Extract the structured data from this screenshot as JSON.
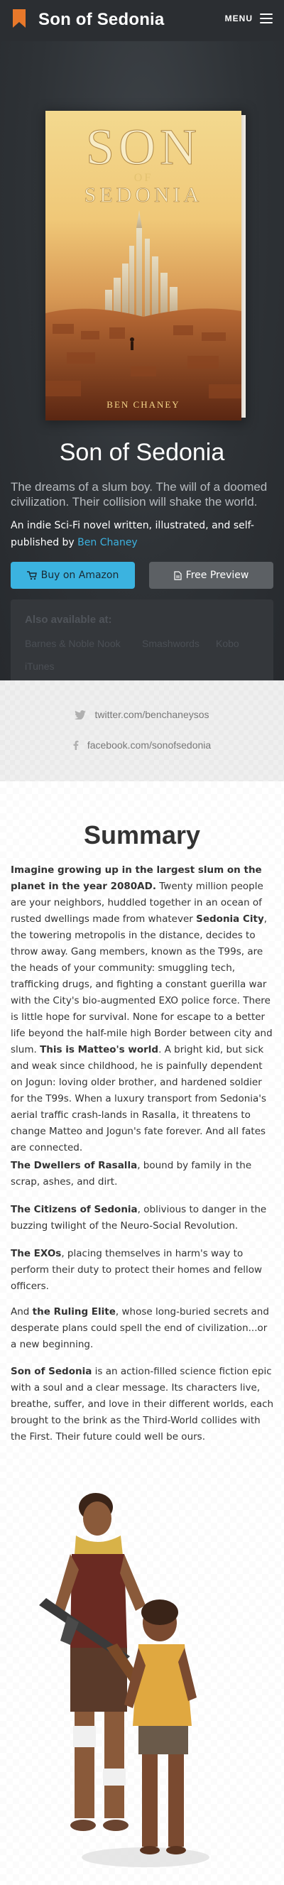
{
  "header": {
    "brand": "Son of Sedonia",
    "menu_label": "MENU",
    "bookmark_icon": "bookmark-icon",
    "menu_icon": "hamburger-icon"
  },
  "hero": {
    "cover": {
      "title_line1": "SON",
      "title_line2": "OF",
      "title_line3": "SEDONIA",
      "author": "BEN CHANEY"
    },
    "title": "Son of Sedonia",
    "tagline": "The dreams of a slum boy. The will of a doomed civilization. Their collision will shake the world.",
    "desc_text": "An indie Sci-Fi novel written, illustrated, and self-published by ",
    "desc_author": "Ben Chaney",
    "buy_label": "Buy on Amazon",
    "preview_label": "Free Preview",
    "also_title": "Also available at:",
    "also_links": [
      "Barnes & Noble Nook",
      "Smashwords",
      "Kobo",
      "iTunes"
    ]
  },
  "social": {
    "twitter": "twitter.com/benchaneysos",
    "facebook": "facebook.com/sonofsedonia"
  },
  "summary": {
    "title": "Summary",
    "p1_intro": "Imagine growing up in the largest slum on the planet in the year 2080AD.",
    "p1_a": " Twenty million people are your neighbors, huddled together in an ocean of rusted dwellings made from whatever ",
    "p1_city": "Sedonia City",
    "p1_b": ", the towering metropolis in the distance, decides to throw away. Gang members, known as the T99s, are the heads of your community: smuggling tech, trafficking drugs, and fighting a constant guerilla war with the City's bio-augmented EXO police force. There is little hope for survival. None for escape to a better life beyond the half-mile high Border between city and slum. ",
    "p1_matteo": "This is Matteo's world",
    "p1_c": ". A bright kid, but sick and weak since childhood, he is painfully dependent on Jogun: loving older brother, and hardened soldier for the T99s. When a luxury transport from Sedonia's aerial traffic crash-lands in Rasalla, it threatens to change Matteo and Jogun's fate forever. And all fates are connected.",
    "p2_bold": "The Dwellers of Rasalla",
    "p2_rest": ", bound by family in the scrap, ashes, and dirt.",
    "p3_bold": "The Citizens of Sedonia",
    "p3_rest": ", oblivious to danger in the buzzing twilight of the Neuro-Social Revolution.",
    "p4_bold": "The EXOs",
    "p4_rest": ", placing themselves in harm's way to perform their duty to protect their homes and fellow officers.",
    "p5_a": "And ",
    "p5_bold": "the Ruling Elite",
    "p5_rest": ", whose long-buried secrets and desperate plans could spell the end of civilization...or a new beginning.",
    "p6_bold": "Son of Sedonia",
    "p6_rest": " is an action-filled science fiction epic with a soul and a clear message. Its characters live, breathe, suffer, and love in their different worlds, each brought to the brink as the Third-World collides with the First. Their future could well be ours."
  },
  "colors": {
    "topbar": "#2b2e32",
    "accent_orange": "#e8782a",
    "link_blue": "#3cb2e0",
    "amazon_button": "#3bb3e0",
    "preview_button": "#5c6064"
  }
}
